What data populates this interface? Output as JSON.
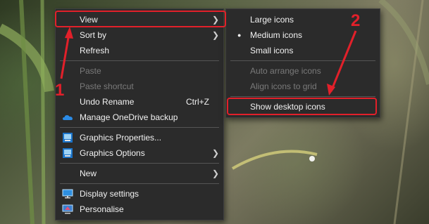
{
  "context_menu": {
    "items": [
      {
        "label": "View"
      },
      {
        "label": "Sort by"
      },
      {
        "label": "Refresh"
      },
      {
        "label": "Paste"
      },
      {
        "label": "Paste shortcut"
      },
      {
        "label": "Undo Rename",
        "shortcut": "Ctrl+Z"
      },
      {
        "label": "Manage OneDrive backup",
        "icon": "onedrive-icon"
      },
      {
        "label": "Graphics Properties...",
        "icon": "graphics-icon"
      },
      {
        "label": "Graphics Options",
        "icon": "graphics-icon"
      },
      {
        "label": "New"
      },
      {
        "label": "Display settings",
        "icon": "display-icon"
      },
      {
        "label": "Personalise",
        "icon": "personalise-icon"
      }
    ]
  },
  "view_submenu": {
    "items": [
      {
        "label": "Large icons"
      },
      {
        "label": "Medium icons",
        "selected": true
      },
      {
        "label": "Small icons"
      },
      {
        "label": "Auto arrange icons"
      },
      {
        "label": "Align icons to grid"
      },
      {
        "label": "Show desktop icons"
      }
    ]
  },
  "annotations": {
    "step1": "1",
    "step2": "2",
    "color": "#e2202a"
  }
}
